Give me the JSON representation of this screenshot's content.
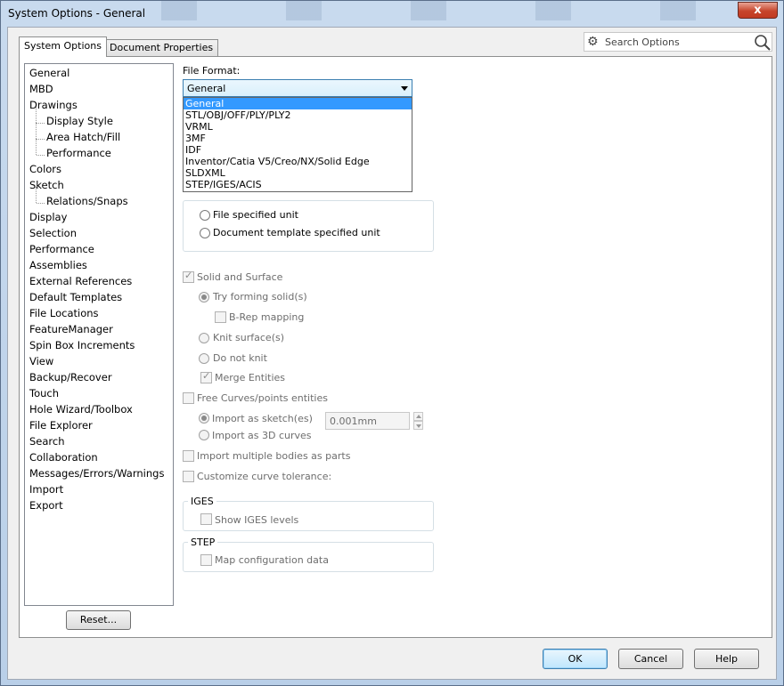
{
  "window": {
    "title": "System Options - General",
    "close_label": "x"
  },
  "tabs": {
    "system_options": "System Options",
    "document_properties": "Document Properties"
  },
  "search": {
    "placeholder": "Search Options"
  },
  "tree": {
    "items": [
      {
        "label": "General",
        "sub": false
      },
      {
        "label": "MBD",
        "sub": false
      },
      {
        "label": "Drawings",
        "sub": false
      },
      {
        "label": "Display Style",
        "sub": true
      },
      {
        "label": "Area Hatch/Fill",
        "sub": true
      },
      {
        "label": "Performance",
        "sub": true
      },
      {
        "label": "Colors",
        "sub": false
      },
      {
        "label": "Sketch",
        "sub": false
      },
      {
        "label": "Relations/Snaps",
        "sub": true
      },
      {
        "label": "Display",
        "sub": false
      },
      {
        "label": "Selection",
        "sub": false
      },
      {
        "label": "Performance",
        "sub": false
      },
      {
        "label": "Assemblies",
        "sub": false
      },
      {
        "label": "External References",
        "sub": false
      },
      {
        "label": "Default Templates",
        "sub": false
      },
      {
        "label": "File Locations",
        "sub": false
      },
      {
        "label": "FeatureManager",
        "sub": false
      },
      {
        "label": "Spin Box Increments",
        "sub": false
      },
      {
        "label": "View",
        "sub": false
      },
      {
        "label": "Backup/Recover",
        "sub": false
      },
      {
        "label": "Touch",
        "sub": false
      },
      {
        "label": "Hole Wizard/Toolbox",
        "sub": false
      },
      {
        "label": "File Explorer",
        "sub": false
      },
      {
        "label": "Search",
        "sub": false
      },
      {
        "label": "Collaboration",
        "sub": false
      },
      {
        "label": "Messages/Errors/Warnings",
        "sub": false
      },
      {
        "label": "Import",
        "sub": false
      },
      {
        "label": "Export",
        "sub": false
      }
    ],
    "reset_label": "Reset..."
  },
  "file_format": {
    "label": "File Format:",
    "selected": "General",
    "options": [
      "General",
      "STL/OBJ/OFF/PLY/PLY2",
      "VRML",
      "3MF",
      "IDF",
      "Inventor/Catia V5/Creo/NX/Solid Edge",
      "SLDXML",
      "STEP/IGES/ACIS"
    ]
  },
  "units": {
    "file_specified_partial": "File specified unit",
    "document_template": "Document template specified unit"
  },
  "solid": {
    "solid_and_surface": "Solid and Surface",
    "try_forming_solids": "Try forming solid(s)",
    "brep_mapping": "B-Rep mapping",
    "knit_surfaces": "Knit surface(s)",
    "do_not_knit": "Do not knit",
    "merge_entities": "Merge Entities"
  },
  "curves": {
    "free_curves": "Free Curves/points entities",
    "import_as_sketch": "Import as sketch(es)",
    "import_as_3d": "Import as 3D curves"
  },
  "other": {
    "import_multiple": "Import multiple bodies as parts",
    "customize_tolerance": "Customize curve tolerance:",
    "tolerance_value": "0.001mm"
  },
  "iges": {
    "legend": "IGES",
    "show_levels": "Show IGES levels"
  },
  "step": {
    "legend": "STEP",
    "map_config": "Map configuration data"
  },
  "buttons": {
    "ok": "OK",
    "cancel": "Cancel",
    "help": "Help"
  }
}
